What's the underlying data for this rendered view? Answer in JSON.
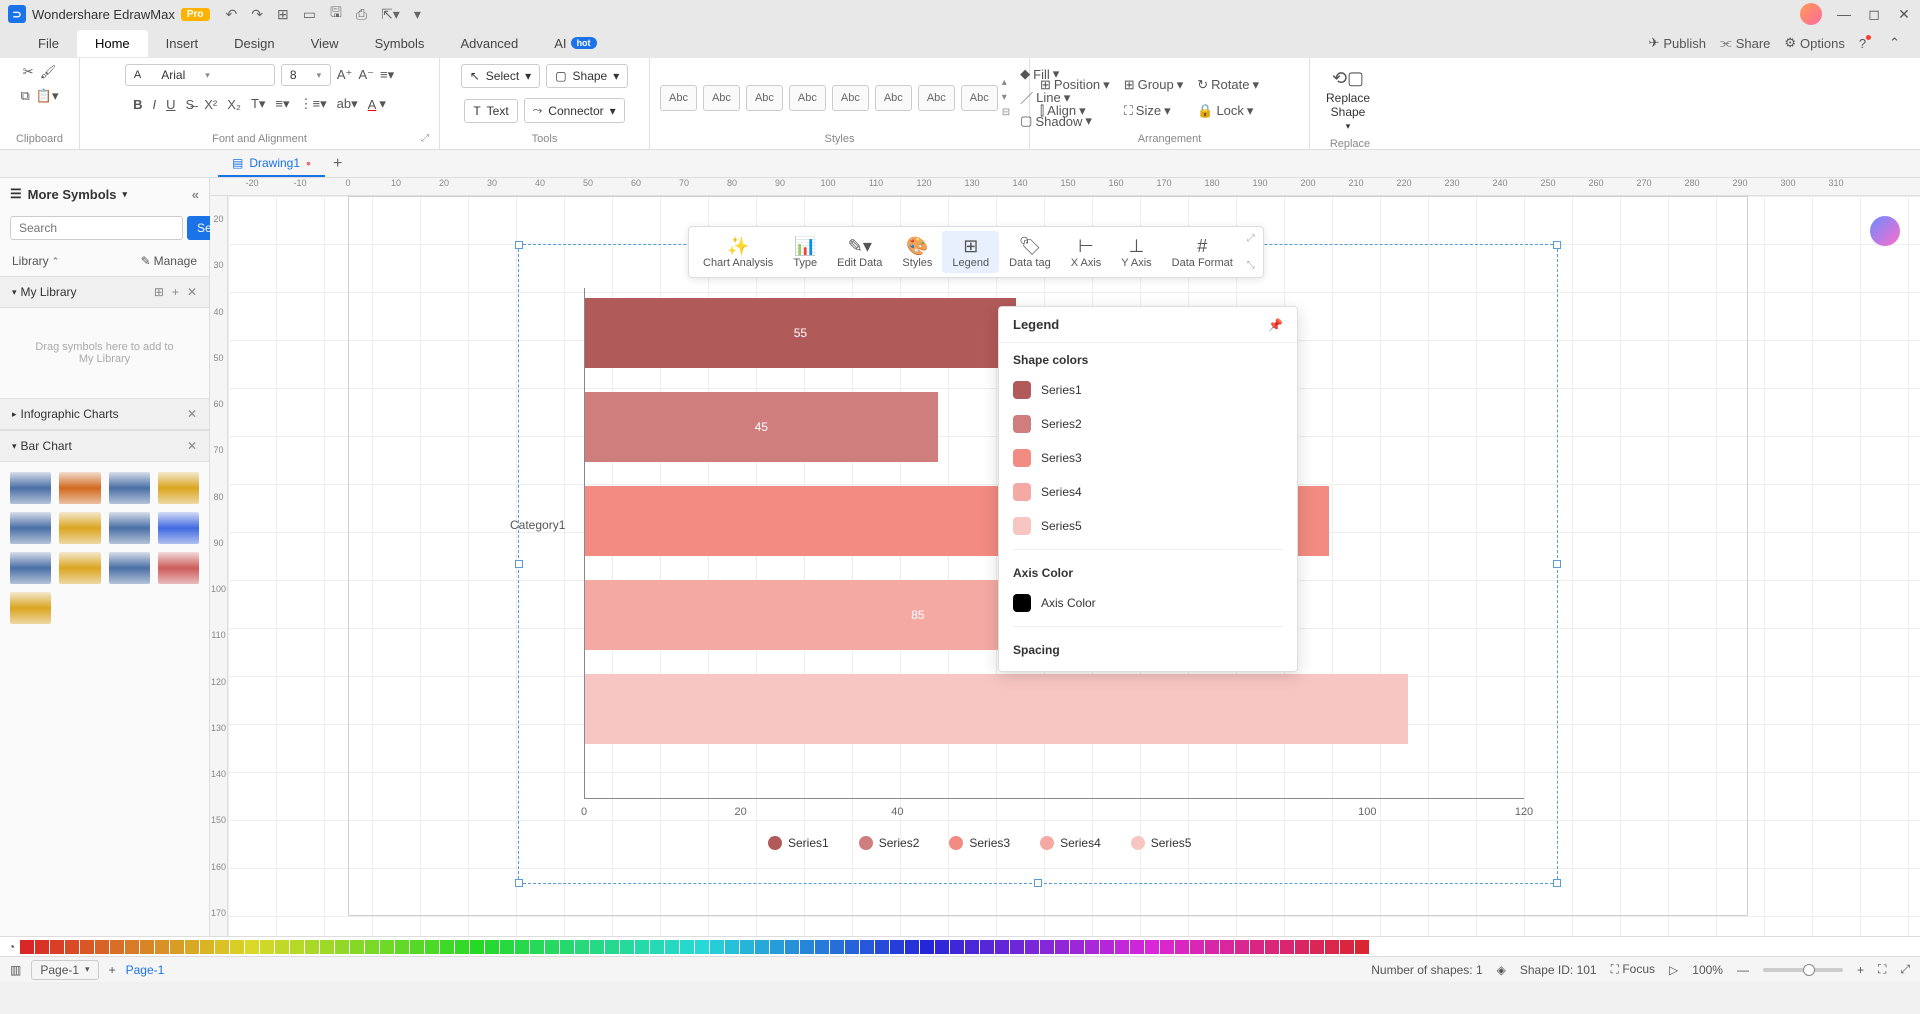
{
  "titlebar": {
    "app_name": "Wondershare EdrawMax",
    "badge": "Pro"
  },
  "menubar": {
    "items": [
      "File",
      "Home",
      "Insert",
      "Design",
      "View",
      "Symbols",
      "Advanced"
    ],
    "active": 1,
    "ai_label": "AI",
    "ai_badge": "hot",
    "right": {
      "publish": "Publish",
      "share": "Share",
      "options": "Options"
    }
  },
  "ribbon": {
    "clipboard": "Clipboard",
    "font_align": "Font and Alignment",
    "tools": "Tools",
    "styles": "Styles",
    "arrangement": "Arrangement",
    "replace_group": "Replace",
    "font_name": "Arial",
    "font_size": "8",
    "select": "Select",
    "shape": "Shape",
    "text": "Text",
    "connector": "Connector",
    "abc": "Abc",
    "fill": "Fill",
    "line": "Line",
    "shadow": "Shadow",
    "position": "Position",
    "align": "Align",
    "group": "Group",
    "size": "Size",
    "rotate": "Rotate",
    "lock": "Lock",
    "replace_shape": "Replace\nShape"
  },
  "doc_tabs": {
    "active": "Drawing1"
  },
  "sidebar": {
    "title": "More Symbols",
    "search_placeholder": "Search",
    "search_button": "Search",
    "library": "Library",
    "manage": "Manage",
    "my_library": "My Library",
    "drop_text": "Drag symbols here to add to My Library",
    "infographic": "Infographic Charts",
    "bar_chart": "Bar Chart"
  },
  "ruler_h": [
    "-20",
    "-10",
    "0",
    "10",
    "20",
    "30",
    "40",
    "50",
    "60",
    "70",
    "80",
    "90",
    "100",
    "110",
    "120",
    "130",
    "140",
    "150",
    "160",
    "170",
    "180",
    "190",
    "200",
    "210",
    "220",
    "230",
    "240",
    "250",
    "260",
    "270",
    "280",
    "290",
    "300",
    "310"
  ],
  "ruler_v": [
    "20",
    "30",
    "40",
    "50",
    "60",
    "70",
    "80",
    "90",
    "100",
    "110",
    "120",
    "130",
    "140",
    "150",
    "160",
    "170"
  ],
  "float_toolbar": {
    "items": [
      "Chart Analysis",
      "Type",
      "Edit Data",
      "Styles",
      "Legend",
      "Data tag",
      "X Axis",
      "Y Axis",
      "Data Format"
    ],
    "active": 4
  },
  "legend_popup": {
    "title": "Legend",
    "shape_colors": "Shape colors",
    "series": [
      "Series1",
      "Series2",
      "Series3",
      "Series4",
      "Series5"
    ],
    "axis_color_title": "Axis Color",
    "axis_color_label": "Axis Color",
    "spacing": "Spacing"
  },
  "chart_data": {
    "type": "bar",
    "orientation": "horizontal",
    "category_label": "Category1",
    "x_ticks": [
      0,
      20,
      40,
      100,
      120
    ],
    "series": [
      {
        "name": "Series1",
        "value": 55,
        "color": "#b15a5a"
      },
      {
        "name": "Series2",
        "value": 45,
        "color": "#cf7d7d"
      },
      {
        "name": "Series3",
        "value": 95,
        "color": "#f28b82"
      },
      {
        "name": "Series4",
        "value": 85,
        "color": "#f4a9a3"
      },
      {
        "name": "Series5",
        "value": 105,
        "color": "#f8c6c2"
      }
    ],
    "visible_labels": {
      "0": 55,
      "1": 45,
      "3": 85
    },
    "x_max": 120
  },
  "statusbar": {
    "page_selector": "Page-1",
    "page_label": "Page-1",
    "shapes": "Number of shapes: 1",
    "shape_id": "Shape ID: 101",
    "focus": "Focus",
    "zoom": "100%"
  }
}
